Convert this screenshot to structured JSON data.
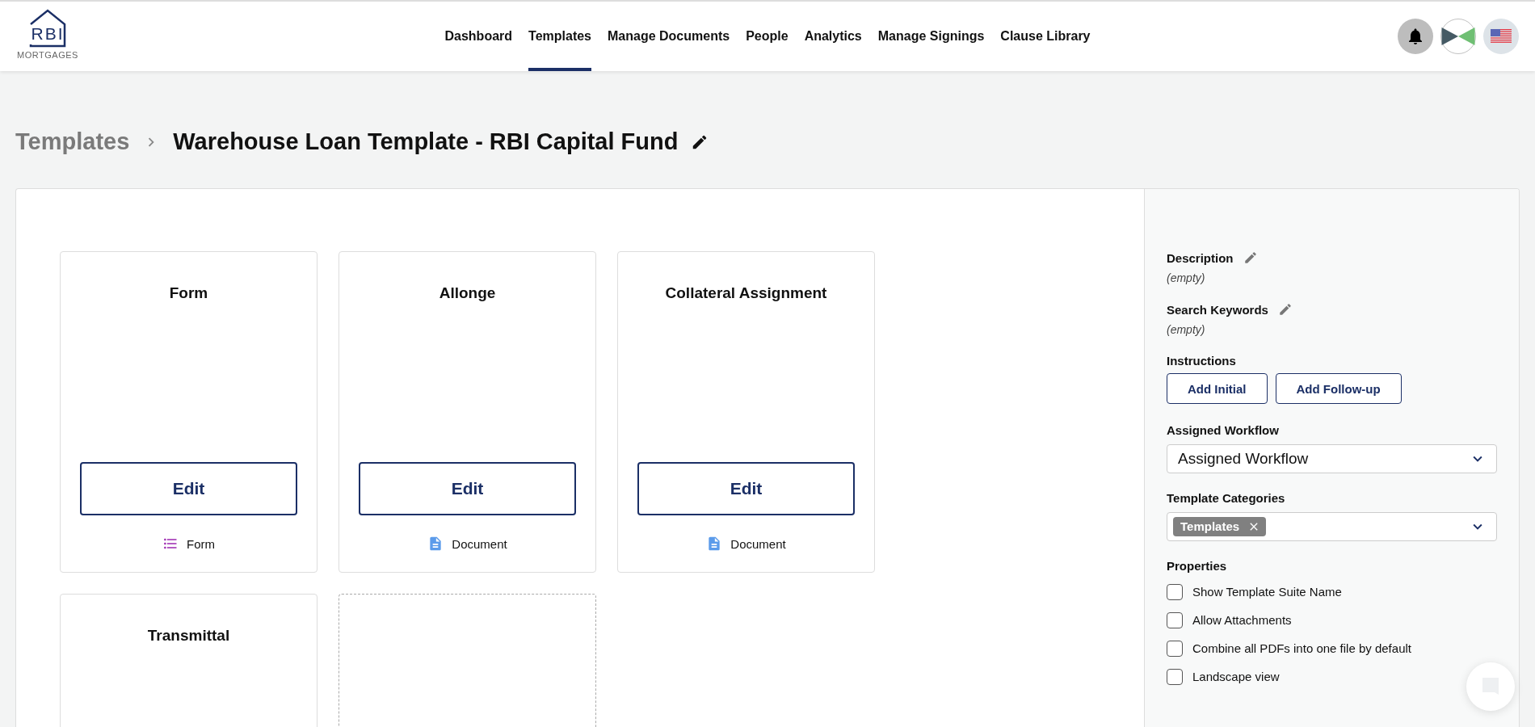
{
  "header": {
    "logo": {
      "mark": "RBI",
      "wordmark": "MORTGAGES"
    },
    "nav": [
      {
        "label": "Dashboard",
        "selected": false
      },
      {
        "label": "Templates",
        "selected": true
      },
      {
        "label": "Manage Documents",
        "selected": false
      },
      {
        "label": "People",
        "selected": false
      },
      {
        "label": "Analytics",
        "selected": false
      },
      {
        "label": "Manage Signings",
        "selected": false
      },
      {
        "label": "Clause Library",
        "selected": false
      }
    ]
  },
  "breadcrumb": {
    "parent": "Templates",
    "title": "Warehouse Loan Template - RBI Capital Fund"
  },
  "cards": [
    {
      "kind": "template",
      "title": "Form",
      "button": "Edit",
      "type": {
        "kind": "form",
        "label": "Form"
      }
    },
    {
      "kind": "template",
      "title": "Allonge",
      "button": "Edit",
      "type": {
        "kind": "document",
        "label": "Document"
      }
    },
    {
      "kind": "template",
      "title": "Collateral Assignment",
      "button": "Edit",
      "type": {
        "kind": "document",
        "label": "Document"
      }
    },
    {
      "kind": "template",
      "title": "Transmittal"
    },
    {
      "kind": "add-slot"
    }
  ],
  "panel": {
    "description": {
      "label": "Description",
      "value": "(empty)"
    },
    "keywords": {
      "label": "Search Keywords",
      "value": "(empty)"
    },
    "instructions": {
      "label": "Instructions",
      "buttons": [
        "Add Initial",
        "Add Follow-up"
      ]
    },
    "workflow": {
      "label": "Assigned Workflow",
      "value": "Assigned Workflow"
    },
    "categories": {
      "label": "Template Categories",
      "tags": [
        "Templates"
      ]
    },
    "properties": {
      "label": "Properties",
      "options": [
        {
          "label": "Show Template Suite Name",
          "checked": false
        },
        {
          "label": "Allow Attachments",
          "checked": false
        },
        {
          "label": "Combine all PDFs into one file by default",
          "checked": false
        },
        {
          "label": "Landscape view",
          "checked": false
        }
      ]
    }
  }
}
